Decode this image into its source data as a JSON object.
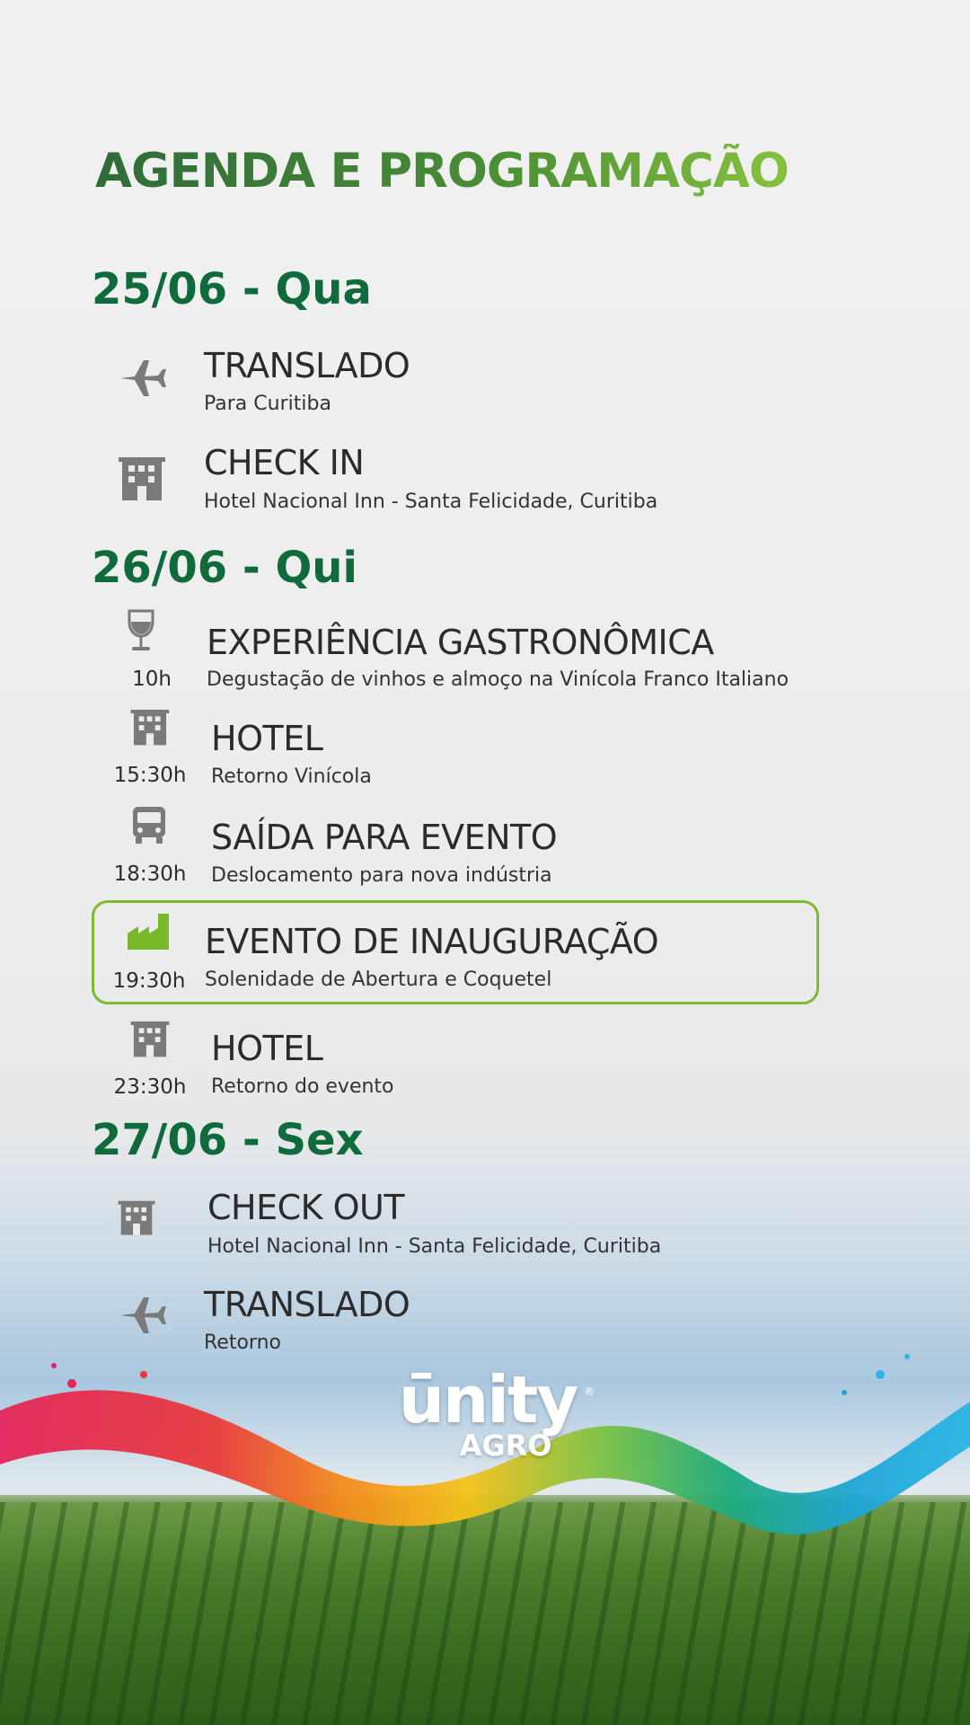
{
  "title": "AGENDA E PROGRAMAÇÃO",
  "colors": {
    "title_start": "#2f6b3a",
    "title_end": "#8cc63f",
    "day": "#0f6a3c",
    "highlight_border": "#7dba2f",
    "icon": "#7a7a7a",
    "factory_icon": "#78b82a"
  },
  "days": [
    {
      "label": "25/06 - Qua",
      "items": [
        {
          "icon": "airplane-icon",
          "time": "",
          "title": "TRANSLADO",
          "subtitle": "Para Curitiba"
        },
        {
          "icon": "building-icon",
          "time": "",
          "title": "CHECK IN",
          "subtitle": "Hotel Nacional Inn - Santa Felicidade, Curitiba"
        }
      ]
    },
    {
      "label": "26/06 - Qui",
      "items": [
        {
          "icon": "wine-glass-icon",
          "time": "10h",
          "title": "EXPERIÊNCIA GASTRONÔMICA",
          "subtitle": "Degustação de vinhos e almoço na Vinícola Franco Italiano"
        },
        {
          "icon": "building-icon",
          "time": "15:30h",
          "title": "HOTEL",
          "subtitle": "Retorno Vinícola"
        },
        {
          "icon": "bus-icon",
          "time": "18:30h",
          "title": "SAÍDA PARA EVENTO",
          "subtitle": "Deslocamento para nova indústria"
        },
        {
          "icon": "factory-icon",
          "time": "19:30h",
          "title": "EVENTO DE INAUGURAÇÃO",
          "subtitle": "Solenidade de Abertura e Coquetel",
          "highlighted": true
        },
        {
          "icon": "building-icon",
          "time": "23:30h",
          "title": "HOTEL",
          "subtitle": "Retorno do evento"
        }
      ]
    },
    {
      "label": "27/06 - Sex",
      "items": [
        {
          "icon": "building-icon",
          "time": "",
          "title": "CHECK OUT",
          "subtitle": "Hotel Nacional Inn - Santa Felicidade, Curitiba"
        },
        {
          "icon": "airplane-icon",
          "time": "",
          "title": "TRANSLADO",
          "subtitle": "Retorno"
        }
      ]
    }
  ],
  "logo": {
    "main": "ūnity",
    "sub": "AGRO",
    "mark": "®"
  }
}
